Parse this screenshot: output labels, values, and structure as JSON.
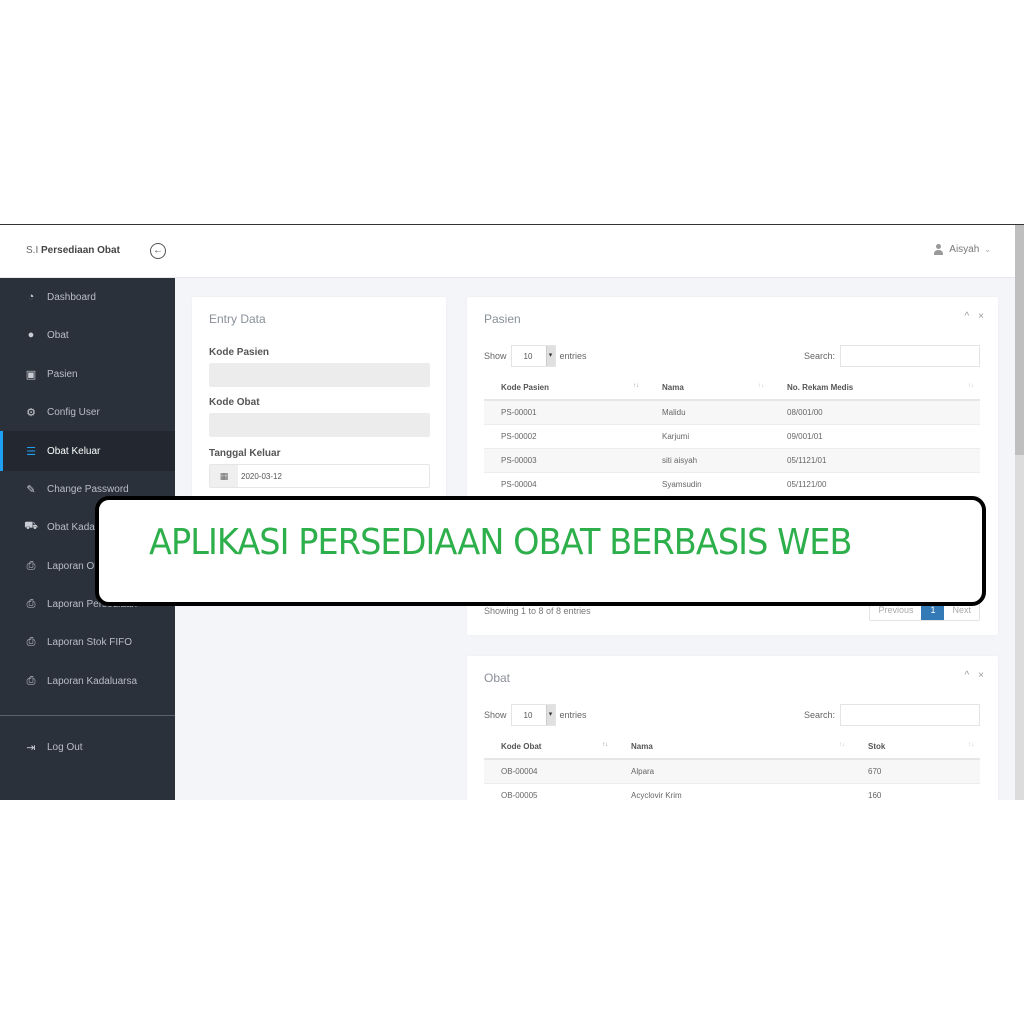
{
  "header": {
    "brand_prefix": "S.I",
    "brand_name": "Persediaan Obat",
    "back_icon": "arrow-left-circle-icon",
    "user_name": "Aisyah",
    "user_caret": "⌄"
  },
  "sidebar": {
    "items": [
      {
        "label": "Dashboard",
        "icon": "dashboard-icon",
        "glyph": "◔"
      },
      {
        "label": "Obat",
        "icon": "pills-icon",
        "glyph": "●"
      },
      {
        "label": "Pasien",
        "icon": "patient-board-icon",
        "glyph": "▣"
      },
      {
        "label": "Config User",
        "icon": "users-cog-icon",
        "glyph": "⚙"
      },
      {
        "label": "Obat Keluar",
        "icon": "outdent-list-icon",
        "glyph": "☰",
        "active": true
      },
      {
        "label": "Change Password",
        "icon": "user-edit-icon",
        "glyph": "✎"
      },
      {
        "label": "Obat Kadaluarsa",
        "icon": "truck-icon",
        "glyph": "⛟"
      },
      {
        "label": "Laporan Obat",
        "icon": "printer-icon",
        "glyph": "⎙"
      },
      {
        "label": "Laporan Persediaan",
        "icon": "printer-icon",
        "glyph": "⎙"
      },
      {
        "label": "Laporan Stok FIFO",
        "icon": "printer-icon",
        "glyph": "⎙"
      },
      {
        "label": "Laporan Kadaluarsa",
        "icon": "printer-icon",
        "glyph": "⎙"
      }
    ],
    "logout": {
      "label": "Log Out",
      "icon": "sign-out-icon",
      "glyph": "⇥"
    }
  },
  "entry": {
    "title": "Entry Data",
    "kode_pasien_label": "Kode Pasien",
    "kode_pasien_value": "",
    "kode_obat_label": "Kode Obat",
    "kode_obat_value": "",
    "tanggal_label": "Tanggal Keluar",
    "tanggal_value": "2020-03-12",
    "calendar_glyph": "▦"
  },
  "pasien": {
    "title": "Pasien",
    "collapse_glyph": "^",
    "close_glyph": "×",
    "show_label": "Show",
    "entries_value": "10",
    "entries_label": "entries",
    "search_label": "Search:",
    "search_value": "",
    "columns": [
      "Kode Pasien",
      "Nama",
      "No. Rekam Medis"
    ],
    "rows": [
      [
        "PS-00001",
        "Malidu",
        "08/001/00"
      ],
      [
        "PS-00002",
        "Karjumi",
        "09/001/01"
      ],
      [
        "PS-00003",
        "siti aisyah",
        "05/1121/01"
      ],
      [
        "PS-00004",
        "Syamsudin",
        "05/1121/00"
      ]
    ],
    "info": "Showing 1 to 8 of 8 entries",
    "pager": {
      "previous": "Previous",
      "current": "1",
      "next": "Next"
    }
  },
  "obat": {
    "title": "Obat",
    "collapse_glyph": "^",
    "close_glyph": "×",
    "show_label": "Show",
    "entries_value": "10",
    "entries_label": "entries",
    "search_label": "Search:",
    "search_value": "",
    "columns": [
      "Kode Obat",
      "Nama",
      "Stok"
    ],
    "rows": [
      [
        "OB-00004",
        "Alpara",
        "670"
      ],
      [
        "OB-00005",
        "Acyclovir Krim",
        "160"
      ]
    ]
  },
  "banner": {
    "text": "APLIKASI PERSEDIAAN OBAT BERBASIS WEB",
    "color": "#2db04b"
  },
  "colors": {
    "sidebar_bg": "#2b313b",
    "accent": "#1e9ff2",
    "pager_active": "#337ab7"
  }
}
